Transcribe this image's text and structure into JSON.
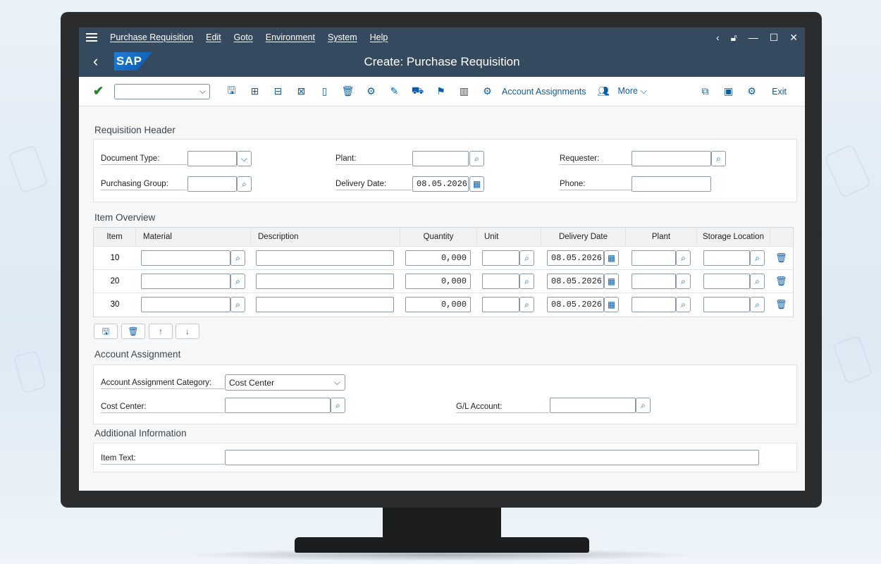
{
  "menu": {
    "items": [
      "Purchase Requisition",
      "Edit",
      "Goto",
      "Environment",
      "System",
      "Help"
    ]
  },
  "header": {
    "logo_text": "SAP",
    "title": "Create: Purchase Requisition"
  },
  "toolbar": {
    "account_assignments_label": "Account Assignments",
    "more_label": "More",
    "exit_label": "Exit"
  },
  "requisition_header": {
    "title": "Requisition Header",
    "document_type_label": "Document Type:",
    "purchasing_group_label": "Purchasing Group:",
    "plant_label": "Plant:",
    "delivery_date_label": "Delivery Date:",
    "delivery_date_value": "08.05.2026",
    "requester_label": "Requester:",
    "phone_label": "Phone:"
  },
  "item_overview": {
    "title": "Item Overview",
    "columns": [
      "Item",
      "Material",
      "Description",
      "Quantity",
      "Unit",
      "Delivery Date",
      "Plant",
      "Storage Location"
    ],
    "rows": [
      {
        "item": "10",
        "quantity": "0,000",
        "delivery_date": "08.05.2026"
      },
      {
        "item": "20",
        "quantity": "0,000",
        "delivery_date": "08.05.2026"
      },
      {
        "item": "30",
        "quantity": "0,000",
        "delivery_date": "08.05.2026"
      }
    ]
  },
  "account_assignment": {
    "title": "Account Assignment",
    "category_label": "Account Assignment Category:",
    "category_value": "Cost Center",
    "cost_center_label": "Cost Center:",
    "gl_account_label": "G/L Account:"
  },
  "additional_info": {
    "title": "Additional Information",
    "item_text_label": "Item Text:"
  },
  "colors": {
    "shell": "#354a5f",
    "accent": "#0a5da6",
    "check": "#2b7c2b"
  }
}
